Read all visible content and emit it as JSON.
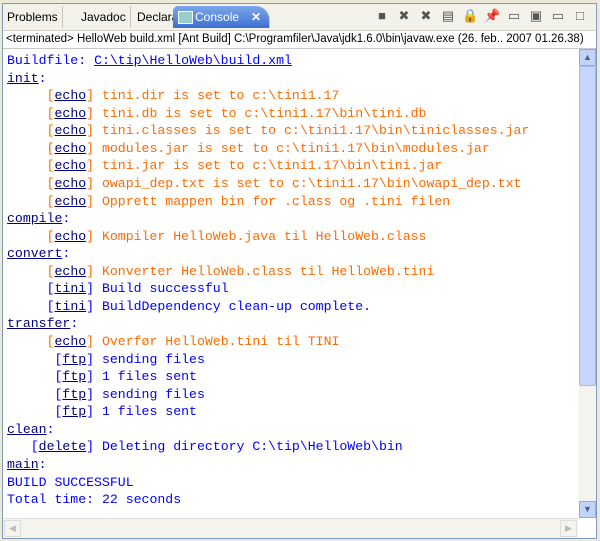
{
  "tabs": [
    {
      "label": "Problems",
      "left": 0
    },
    {
      "label": "Javadoc"
    },
    {
      "label": "Declaration"
    },
    {
      "label": "Console",
      "active": true
    }
  ],
  "toolbar_icons": [
    "terminate-icon",
    "remove-launch-icon",
    "remove-all-icon",
    "clear-console-icon",
    "scroll-lock-icon",
    "pin-console-icon",
    "display-console-icon",
    "open-console-icon",
    "minimize-icon",
    "maximize-icon"
  ],
  "status": "<terminated> HelloWeb build.xml [Ant Build] C:\\Programfiler\\Java\\jdk1.6.0\\bin\\javaw.exe (26. feb.. 2007 01.26.38)",
  "buildfile": {
    "label": "Buildfile: ",
    "path": "C:\\tip\\HelloWeb\\build.xml"
  },
  "lines": [
    {
      "target": "init"
    },
    {
      "task": "echo",
      "msg": "tini.dir is set to c:\\tini1.17"
    },
    {
      "task": "echo",
      "msg": "tini.db is set to c:\\tini1.17\\bin\\tini.db"
    },
    {
      "task": "echo",
      "msg": "tini.classes is set to c:\\tini1.17\\bin\\tiniclasses.jar"
    },
    {
      "task": "echo",
      "msg": "modules.jar is set to c:\\tini1.17\\bin\\modules.jar"
    },
    {
      "task": "echo",
      "msg": "tini.jar is set to c:\\tini1.17\\bin\\tini.jar"
    },
    {
      "task": "echo",
      "msg": "owapi_dep.txt is set to c:\\tini1.17\\bin\\owapi_dep.txt"
    },
    {
      "task": "echo",
      "msg": "Opprett mappen bin for .class og .tini filen"
    },
    {
      "target": "compile"
    },
    {
      "task": "echo",
      "msg": "Kompiler HelloWeb.java til HelloWeb.class"
    },
    {
      "target": "convert"
    },
    {
      "task": "echo",
      "msg": "Konverter HelloWeb.class til HelloWeb.tini"
    },
    {
      "task": "tini",
      "msg": "Build successful"
    },
    {
      "task": "tini",
      "msg": "BuildDependency clean-up complete."
    },
    {
      "target": "transfer"
    },
    {
      "task": "echo",
      "msg": "Overfør HelloWeb.tini til TINI"
    },
    {
      "task": "ftp",
      "msg": "sending files"
    },
    {
      "task": "ftp",
      "msg": "1 files sent"
    },
    {
      "task": "ftp",
      "msg": "sending files"
    },
    {
      "task": "ftp",
      "msg": "1 files sent"
    },
    {
      "target": "clean"
    },
    {
      "task": "delete",
      "msg": "Deleting directory C:\\tip\\HelloWeb\\bin"
    },
    {
      "target": "main"
    },
    {
      "text": "BUILD SUCCESSFUL"
    },
    {
      "text": "Total time: 22 seconds"
    }
  ],
  "colors": {
    "echo": "#ff6a00",
    "info": "#0000ff",
    "link": "#00007f"
  }
}
